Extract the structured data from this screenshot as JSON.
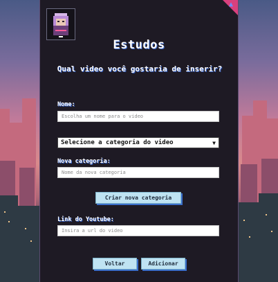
{
  "page": {
    "title": "Estudos",
    "question": "Qual video você gostaria de inserir?"
  },
  "form": {
    "name_label": "Nome:",
    "name_placeholder": "Escolha um nome para o video",
    "category_select_value": "Selecione a categoria do video",
    "new_category_label": "Nova categoria:",
    "new_category_placeholder": "Nome da nova categoria",
    "create_category_button": "Criar nova categoria",
    "youtube_label": "Link do Youtube:",
    "youtube_placeholder": "Insira a url do video"
  },
  "actions": {
    "back_button": "Voltar",
    "add_button": "Adicionar"
  },
  "icons": {
    "avatar": "avatar-pixel-character",
    "corner": "corner-badge-icon",
    "select_arrow": "chevron-down-icon"
  },
  "colors": {
    "panel": "#1e1a24",
    "accent_shadow": "#3b6bd1",
    "button": "#bfe3f2",
    "corner": "#d9407e"
  }
}
